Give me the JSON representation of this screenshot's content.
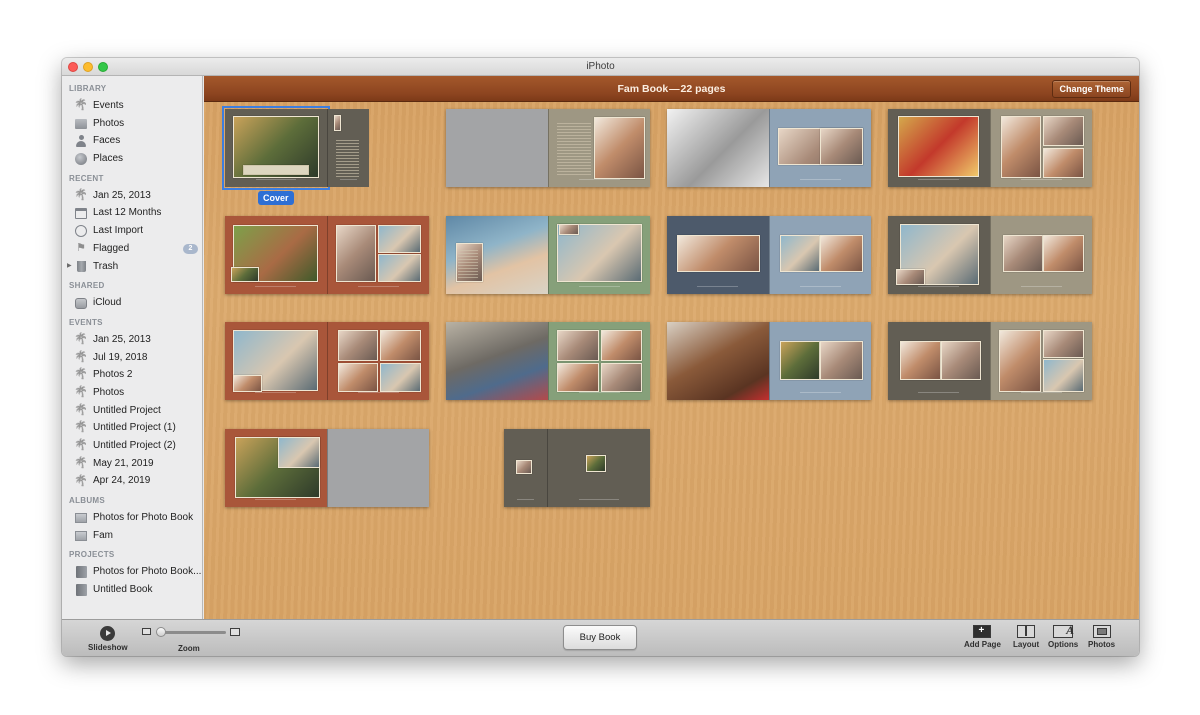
{
  "window": {
    "title": "iPhoto"
  },
  "sidebar": {
    "sections": [
      {
        "title": "LIBRARY",
        "items": [
          {
            "label": "Events",
            "icon": "palm-tree-icon"
          },
          {
            "label": "Photos",
            "icon": "photos-icon"
          },
          {
            "label": "Faces",
            "icon": "person-icon"
          },
          {
            "label": "Places",
            "icon": "globe-icon"
          }
        ]
      },
      {
        "title": "RECENT",
        "items": [
          {
            "label": "Jan 25, 2013",
            "icon": "palm-tree-icon"
          },
          {
            "label": "Last 12 Months",
            "icon": "calendar-icon"
          },
          {
            "label": "Last Import",
            "icon": "clock-icon"
          },
          {
            "label": "Flagged",
            "icon": "flag-icon",
            "badge": "2"
          },
          {
            "label": "Trash",
            "icon": "trash-icon"
          }
        ]
      },
      {
        "title": "SHARED",
        "items": [
          {
            "label": "iCloud",
            "icon": "icloud-icon"
          }
        ]
      },
      {
        "title": "EVENTS",
        "items": [
          {
            "label": "Jan 25, 2013",
            "icon": "palm-tree-icon"
          },
          {
            "label": "Jul 19, 2018",
            "icon": "palm-tree-icon"
          },
          {
            "label": "Photos 2",
            "icon": "palm-tree-icon"
          },
          {
            "label": "Photos",
            "icon": "palm-tree-icon"
          },
          {
            "label": "Untitled Project",
            "icon": "palm-tree-icon"
          },
          {
            "label": "Untitled Project (1)",
            "icon": "palm-tree-icon"
          },
          {
            "label": "Untitled Project (2)",
            "icon": "palm-tree-icon"
          },
          {
            "label": "May 21, 2019",
            "icon": "palm-tree-icon"
          },
          {
            "label": "Apr 24, 2019",
            "icon": "palm-tree-icon"
          }
        ]
      },
      {
        "title": "ALBUMS",
        "items": [
          {
            "label": "Photos for Photo Book",
            "icon": "album-icon"
          },
          {
            "label": "Fam",
            "icon": "album-icon"
          }
        ]
      },
      {
        "title": "PROJECTS",
        "items": [
          {
            "label": "Photos for Photo Book...",
            "icon": "book-icon"
          },
          {
            "label": "Untitled Book",
            "icon": "book-icon"
          }
        ]
      }
    ]
  },
  "content": {
    "header_title": "Fam Book — 22 pages",
    "change_theme_label": "Change Theme",
    "cover_label": "Cover",
    "colors": {
      "selection": "#3d7ee0",
      "brown": "#a9563a",
      "slate": "#4d5a6b",
      "blue": "#8fa3b6",
      "olive": "#625e54",
      "taupe": "#9e9783",
      "green": "#86a07a",
      "grey": "#a3a4a6"
    },
    "spreads": [
      {
        "name": "cover",
        "left": "olive",
        "right": "olive"
      },
      {
        "name": "spread-1",
        "left": "grey",
        "right": "taupe"
      },
      {
        "name": "spread-2",
        "left": "photo-bw",
        "right": "blue"
      },
      {
        "name": "spread-3",
        "left": "olive",
        "right": "taupe"
      },
      {
        "name": "spread-4",
        "left": "brown",
        "right": "brown"
      },
      {
        "name": "spread-5",
        "left": "photo-beach",
        "right": "green"
      },
      {
        "name": "spread-6",
        "left": "slate",
        "right": "blue"
      },
      {
        "name": "spread-7",
        "left": "olive",
        "right": "taupe"
      },
      {
        "name": "spread-8",
        "left": "brown",
        "right": "brown"
      },
      {
        "name": "spread-9",
        "left": "photo-room",
        "right": "green"
      },
      {
        "name": "spread-10",
        "left": "photo-child",
        "right": "blue"
      },
      {
        "name": "spread-11",
        "left": "olive",
        "right": "taupe"
      },
      {
        "name": "spread-12",
        "left": "brown",
        "right": "grey"
      },
      {
        "name": "back-cover",
        "left": "olive",
        "right": "olive"
      }
    ]
  },
  "toolbar": {
    "slideshow_label": "Slideshow",
    "zoom_label": "Zoom",
    "zoom_level": 0.05,
    "buy_book_label": "Buy Book",
    "add_page_label": "Add Page",
    "layout_label": "Layout",
    "options_label": "Options",
    "photos_label": "Photos"
  }
}
